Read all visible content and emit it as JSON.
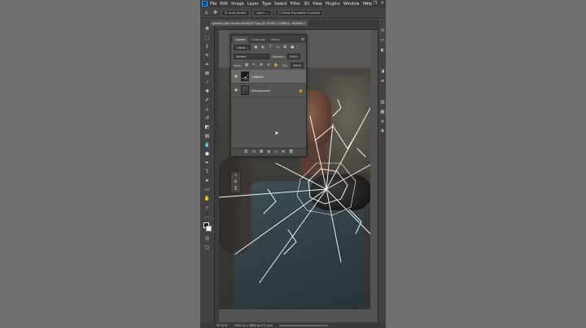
{
  "app": {
    "logo": "Ps",
    "menu": [
      "File",
      "Edit",
      "Image",
      "Layer",
      "Type",
      "Select",
      "Filter",
      "3D",
      "View",
      "Plugins",
      "Window",
      "Help"
    ],
    "window_controls": [
      "—",
      "❐",
      "✕"
    ]
  },
  "options_bar": {
    "auto_select": "Auto-Select",
    "layer_dropdown": "Layer",
    "show_transform": "Show Transform Controls"
  },
  "document": {
    "tab_title": "pexels-julia-larson-6456227.jpg @ 25.6% (158841, RGB/8) *",
    "status_zoom": "25.57%",
    "status_size": "3500 px x 3860 px (72 ppi)"
  },
  "layers_panel": {
    "tabs": [
      "Layers",
      "Channels",
      "Paths"
    ],
    "active_tab": 0,
    "filter_kind": "Kind",
    "blend_mode": "Screen",
    "opacity_label": "Opacity:",
    "opacity_value": "100%",
    "lock_label": "Lock:",
    "fill_label": "Fill:",
    "fill_value": "100%",
    "layers": [
      {
        "name": "158841",
        "selected": true,
        "visible": true
      },
      {
        "name": "Background",
        "selected": false,
        "visible": true,
        "locked": true
      }
    ],
    "footer_icons": [
      "link-icon",
      "fx-icon",
      "mask-icon",
      "adjustment-icon",
      "folder-icon",
      "new-layer-icon",
      "trash-icon"
    ]
  },
  "colors": {
    "menubar": "#3a3a3a",
    "panel": "#535353",
    "accent": "#31a8ff",
    "side_gray": "#707070"
  }
}
